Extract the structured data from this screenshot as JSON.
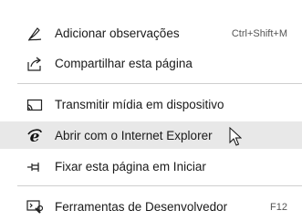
{
  "menu": {
    "items": [
      {
        "label": "Adicionar observações",
        "shortcut": "Ctrl+Shift+M",
        "icon": "pen-note-icon"
      },
      {
        "label": "Compartilhar esta página",
        "shortcut": "",
        "icon": "share-icon"
      },
      {
        "label": "Transmitir mídia em dispositivo",
        "shortcut": "",
        "icon": "cast-icon"
      },
      {
        "label": "Abrir com o Internet Explorer",
        "shortcut": "",
        "icon": "internet-explorer-icon"
      },
      {
        "label": "Fixar esta página em Iniciar",
        "shortcut": "",
        "icon": "pin-icon"
      },
      {
        "label": "Ferramentas de Desenvolvedor",
        "shortcut": "F12",
        "icon": "developer-tools-icon"
      }
    ],
    "highlighted_index": 3
  },
  "colors": {
    "highlight": "#e8e8e8",
    "text": "#1a1a1a",
    "shortcut": "#555555",
    "divider": "#cfcfcf"
  }
}
